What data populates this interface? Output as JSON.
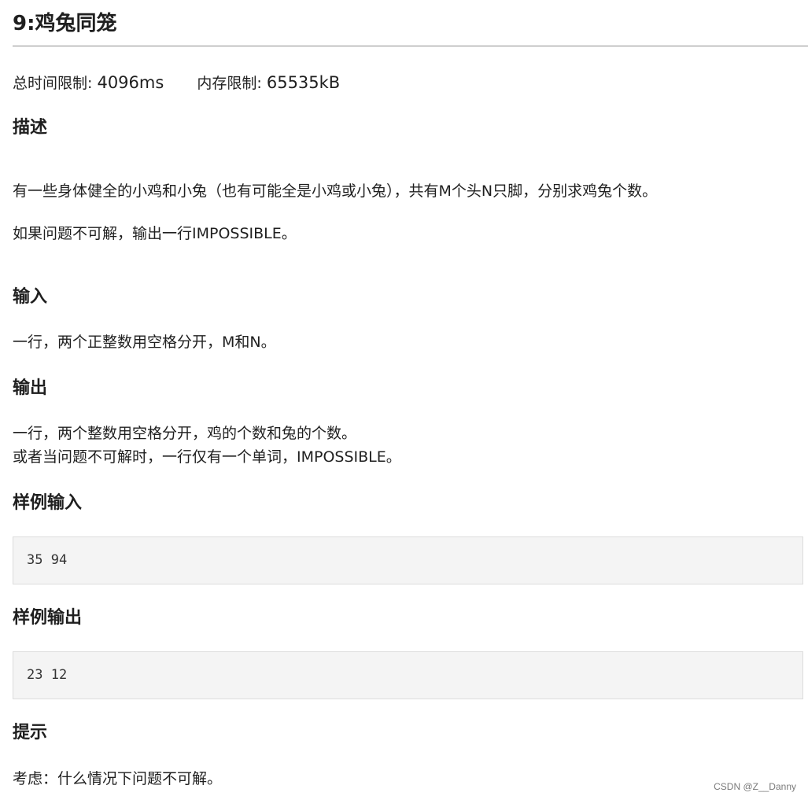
{
  "problem": {
    "title": "9:鸡兔同笼",
    "time_limit_label": "总时间限制:",
    "time_limit_value": "4096ms",
    "memory_limit_label": "内存限制:",
    "memory_limit_value": "65535kB"
  },
  "description": {
    "heading": "描述",
    "line1": "有一些身体健全的小鸡和小兔（也有可能全是小鸡或小兔），共有M个头N只脚，分别求鸡兔个数。",
    "line2": "如果问题不可解，输出一行IMPOSSIBLE。"
  },
  "input": {
    "heading": "输入",
    "line1": "一行，两个正整数用空格分开，M和N。"
  },
  "output": {
    "heading": "输出",
    "line1": "一行，两个整数用空格分开，鸡的个数和兔的个数。",
    "line2": "或者当问题不可解时，一行仅有一个单词，IMPOSSIBLE。"
  },
  "sample_input": {
    "heading": "样例输入",
    "code": "35 94"
  },
  "sample_output": {
    "heading": "样例输出",
    "code": "23 12"
  },
  "hint": {
    "heading": "提示",
    "line1": "考虑：什么情况下问题不可解。"
  },
  "watermark": "CSDN @Z__Danny"
}
